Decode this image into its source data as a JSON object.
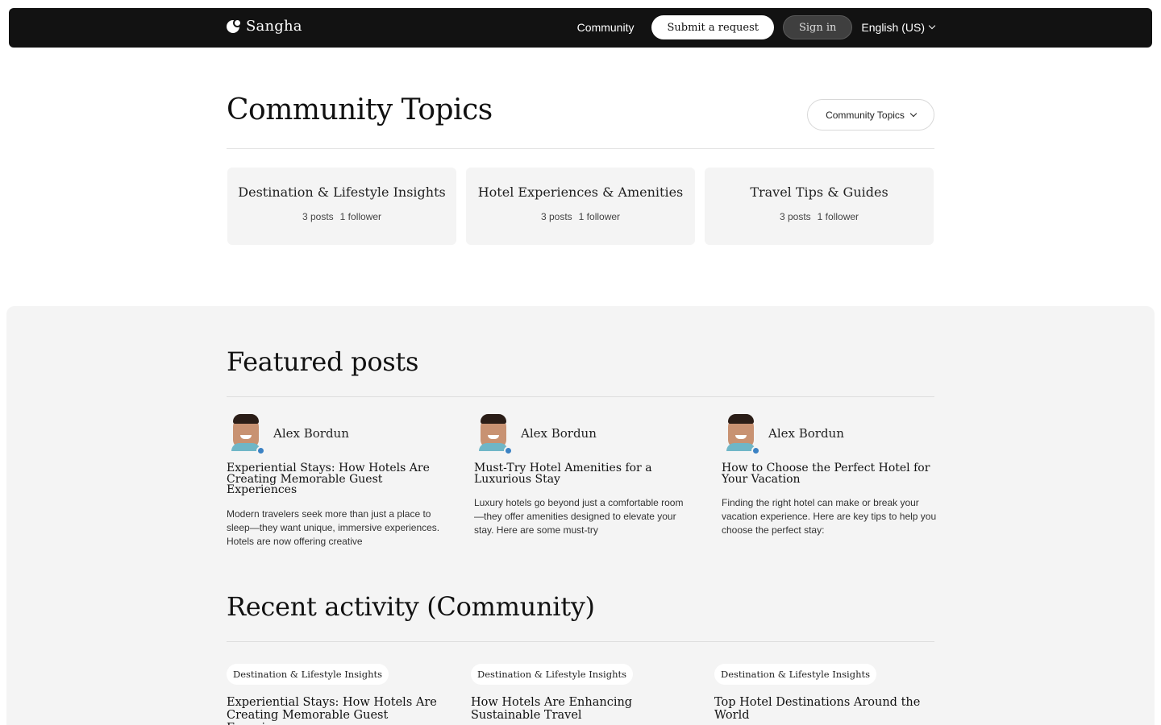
{
  "header": {
    "brand": "Sangha",
    "nav_community": "Community",
    "submit_request": "Submit a request",
    "sign_in": "Sign in",
    "language": "English (US)"
  },
  "topics_section": {
    "title": "Community Topics",
    "select_label": "Community Topics",
    "cards": [
      {
        "title": "Destination & Lifestyle Insights",
        "posts": "3 posts",
        "followers": "1 follower"
      },
      {
        "title": "Hotel Experiences & Amenities",
        "posts": "3 posts",
        "followers": "1 follower"
      },
      {
        "title": "Travel Tips & Guides",
        "posts": "3 posts",
        "followers": "1 follower"
      }
    ]
  },
  "featured": {
    "title": "Featured posts",
    "posts": [
      {
        "author": "Alex Bordun",
        "title": "Experiential Stays: How Hotels Are Creating Memorable Guest Experiences",
        "excerpt": "Modern travelers seek more than just a place to sleep—they want unique, immersive experiences. Hotels are now offering creative"
      },
      {
        "author": "Alex Bordun",
        "title": "Must-Try Hotel Amenities for a Luxurious Stay",
        "excerpt": "Luxury hotels go beyond just a comfortable room—they offer amenities designed to elevate your stay. Here are some must-try"
      },
      {
        "author": "Alex Bordun",
        "title": "How to Choose the Perfect Hotel for Your Vacation",
        "excerpt": "Finding the right hotel can make or break your vacation experience. Here are key tips to help you choose the perfect stay:"
      }
    ]
  },
  "recent": {
    "title": "Recent activity (Community)",
    "items": [
      {
        "tag": "Destination & Lifestyle Insights",
        "title": "Experiential Stays: How Hotels Are Creating Memorable Guest Experiences"
      },
      {
        "tag": "Destination & Lifestyle Insights",
        "title": "How Hotels Are Enhancing Sustainable Travel"
      },
      {
        "tag": "Destination & Lifestyle Insights",
        "title": "Top Hotel Destinations Around the World"
      }
    ]
  },
  "icons": {
    "brand_logo": "brand-logo-icon",
    "language_chevron": "chevron-down-icon",
    "select_chevron": "chevron-down-icon",
    "avatar_badge": "verified-badge-icon"
  },
  "colors": {
    "header_bg": "#121212",
    "section_bg": "#f4f4f4",
    "card_bg": "#f4f4f4",
    "badge": "#3b82c4"
  }
}
